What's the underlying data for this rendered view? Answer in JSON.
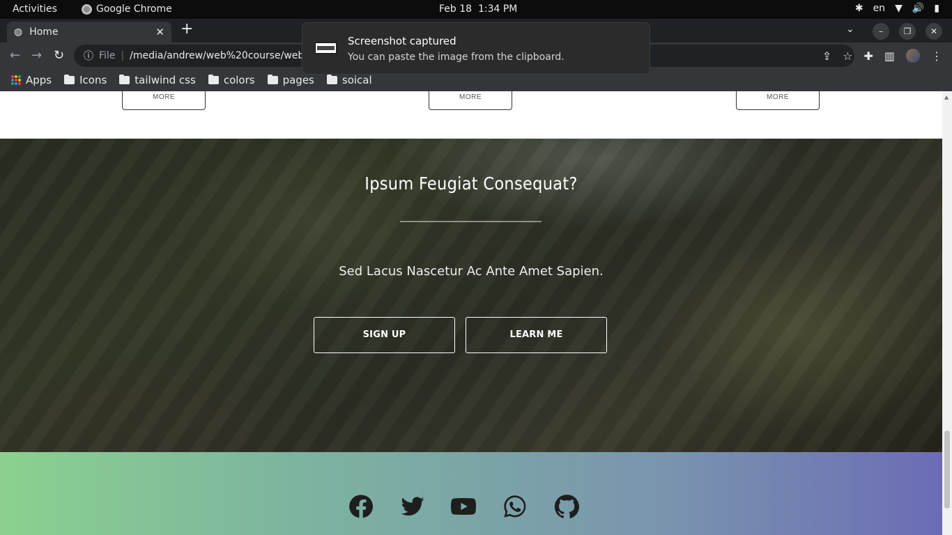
{
  "system": {
    "activities": "Activities",
    "app_name": "Google Chrome",
    "date": "Feb 18",
    "time": "1:34 PM",
    "language": "en"
  },
  "browser": {
    "tab_title": "Home",
    "url_scheme": "File",
    "url": "/media/andrew/web%20course/web/Pr",
    "bookmarks": [
      "Apps",
      "Icons",
      "tailwind css",
      "colors",
      "pages",
      "soical"
    ]
  },
  "notification": {
    "title": "Screenshot captured",
    "body": "You can paste the image from the clipboard."
  },
  "page": {
    "cards": {
      "more_label": "MORE"
    },
    "hero": {
      "title": "Ipsum Feugiat Consequat?",
      "subtitle": "Sed Lacus Nascetur Ac Ante Amet Sapien.",
      "signup": "SIGN UP",
      "learn": "LEARN ME"
    },
    "footer": {
      "social": [
        "facebook-icon",
        "twitter-icon",
        "youtube-icon",
        "whatsapp-icon",
        "github-icon"
      ],
      "gradient": [
        "#8bd18f",
        "#6c6cb6"
      ]
    }
  }
}
